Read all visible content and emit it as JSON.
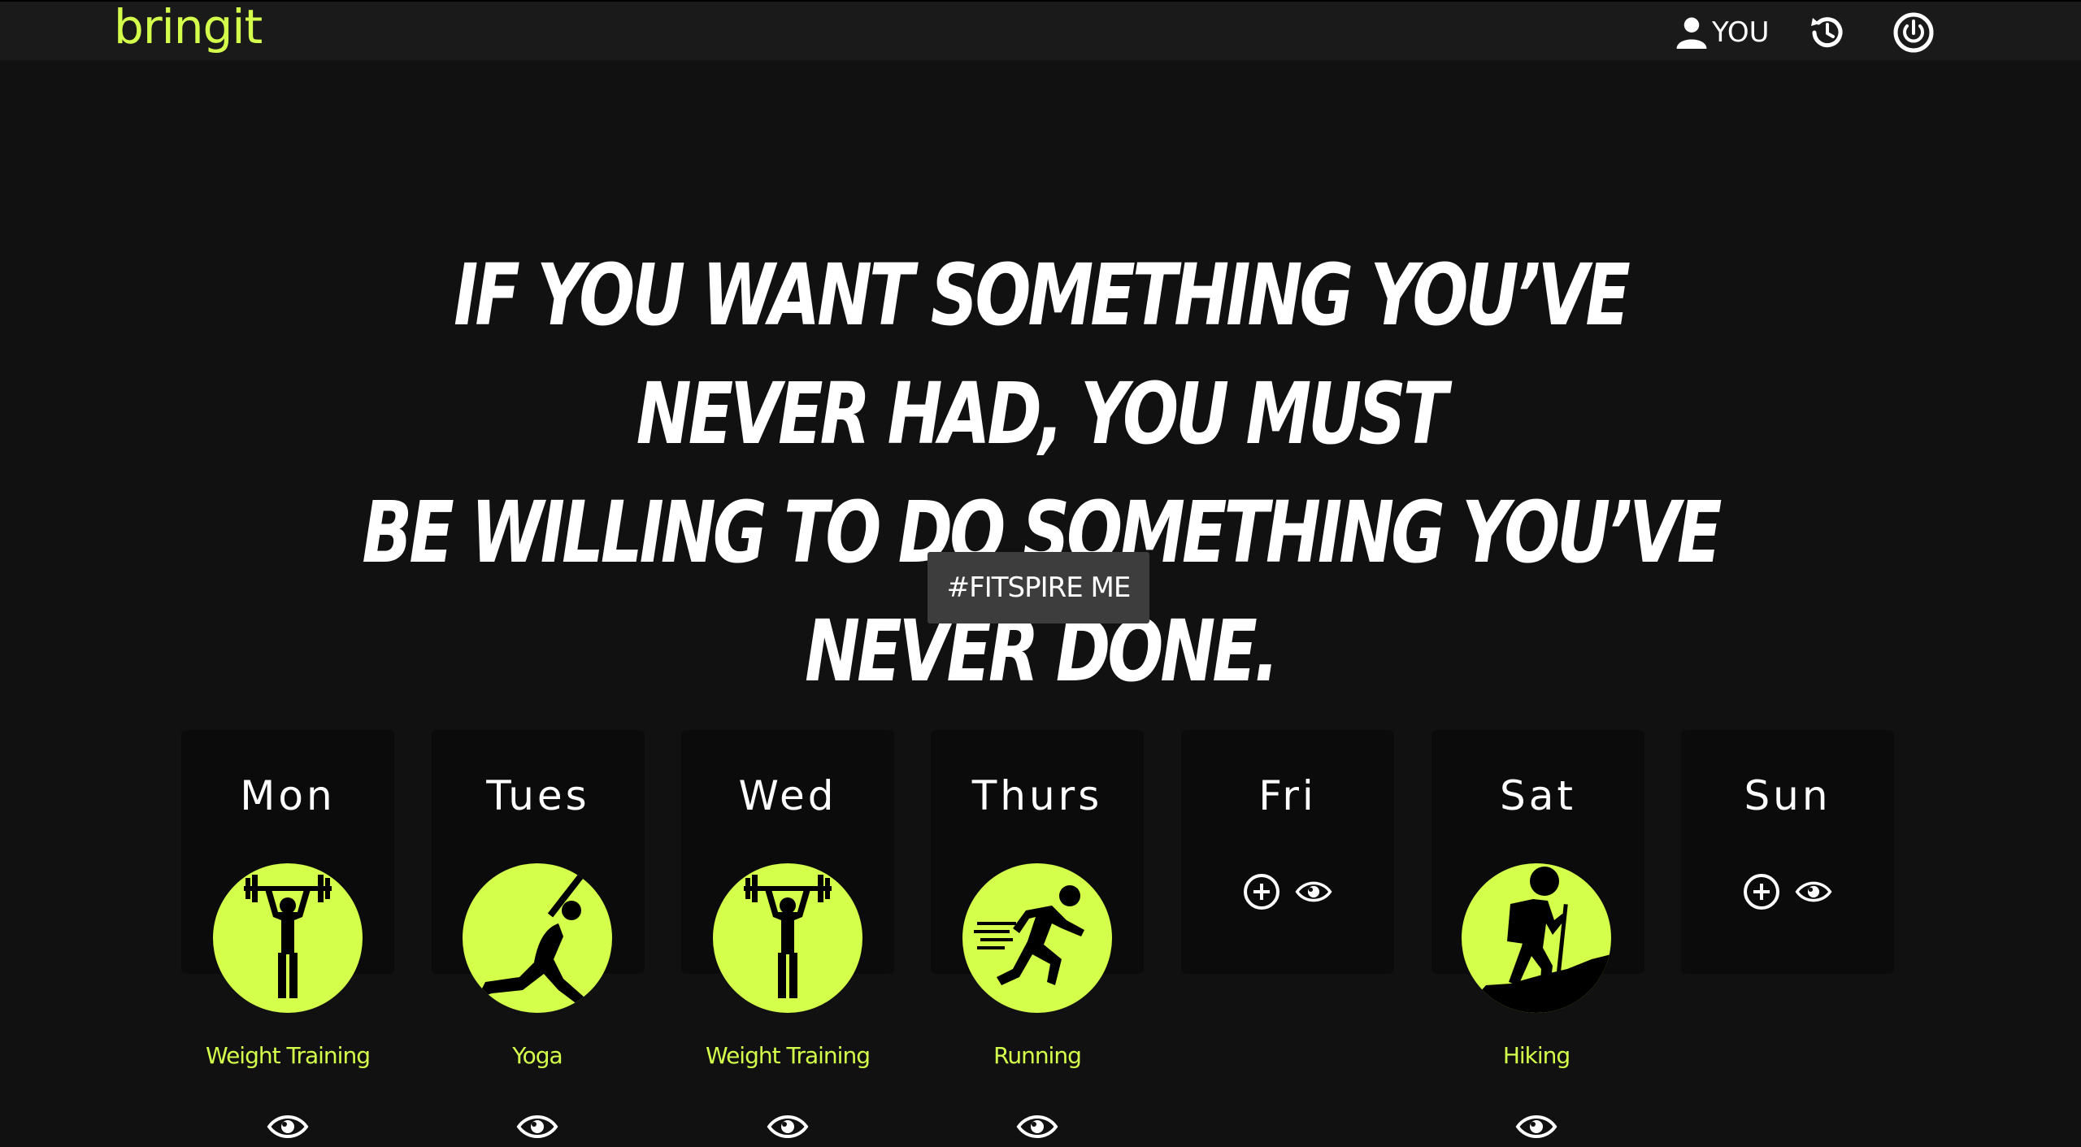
{
  "brand": {
    "name": "bringit",
    "color": "#d4ff4a"
  },
  "nav": {
    "user_label": "YOU",
    "user_icon": "user-icon",
    "history_icon": "history-icon",
    "power_icon": "power-icon"
  },
  "quote": {
    "line1": "IF YOU WANT SOMETHING YOU’VE NEVER HAD, YOU MUST",
    "line2": "BE WILLING TO DO SOMETHING YOU’VE NEVER DONE."
  },
  "cta": {
    "label": "#FITSPIRE ME"
  },
  "days": [
    {
      "name": "Mon",
      "activity": "Weight Training",
      "icon": "weightlifting-icon"
    },
    {
      "name": "Tues",
      "activity": "Yoga",
      "icon": "yoga-icon"
    },
    {
      "name": "Wed",
      "activity": "Weight Training",
      "icon": "weightlifting-icon"
    },
    {
      "name": "Thurs",
      "activity": "Running",
      "icon": "running-icon"
    },
    {
      "name": "Fri",
      "activity": null,
      "icon": null
    },
    {
      "name": "Sat",
      "activity": "Hiking",
      "icon": "hiking-icon"
    },
    {
      "name": "Sun",
      "activity": null,
      "icon": null
    }
  ],
  "colors": {
    "accent": "#d4ff4a",
    "background": "#111111",
    "card": "#0b0b0b",
    "button": "#3d3d3d"
  }
}
